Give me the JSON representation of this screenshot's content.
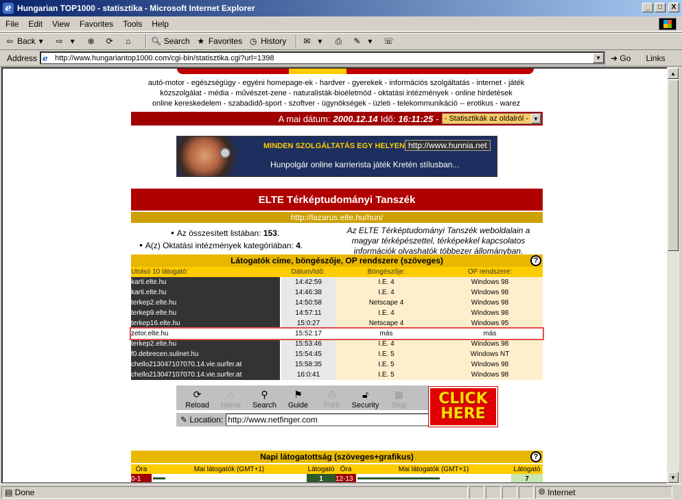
{
  "window": {
    "title": "Hungarian TOP1000 - statisztika - Microsoft Internet Explorer",
    "min": "_",
    "max": "□",
    "close": "X"
  },
  "menu": [
    "File",
    "Edit",
    "View",
    "Favorites",
    "Tools",
    "Help"
  ],
  "toolbar": {
    "back": "Back",
    "search": "Search",
    "favorites": "Favorites",
    "history": "History"
  },
  "address": {
    "label": "Address",
    "url": "http://www.hungariantop1000.com/cgi-bin/statisztika.cgi?url=1398",
    "go": "Go",
    "links": "Links"
  },
  "categories": [
    "autó-motor - egészségügy - egyéni homepage-ek - hardver - gyerekek - információs szolgáltatás - internet - játék",
    "közszolgálat - média - művészet-zene - naturalisták-bioéletmód - oktatási intézmények - online hirdetések",
    "online kereskedelem - szabadidő-sport - szoftver - ügynökségek - üzleti - telekommunikáció -- erotikus - warez"
  ],
  "datebar": {
    "prefix": "A mai dátum:",
    "date": "2000.12.14",
    "time_label": "Idő:",
    "time": "16:11:25",
    "dash": "-",
    "select": "- Statisztikák az oldalról -"
  },
  "banner": {
    "slogan": "MINDEN SZOLGÁLTATÁS EGY HELYEN!!!",
    "url": "http://www.hunnia.net",
    "desc": "Hunpolgár online karrierista játék Kretén stílusban..."
  },
  "site": {
    "title": "ELTE Térképtudományi Tanszék",
    "url": "http://lazarus.elte.hu/hun/",
    "rank1_label": "Az összesített listában:",
    "rank1": "153",
    "rank2_label": "A(z) Oktatási intézmények kategóriában:",
    "rank2": "4",
    "note": "Az ELTE Térképtudományi Tanszék weboldalain a magyar térképészettel, térképekkel kapcsolatos információk olvashatók többezer állományban."
  },
  "visitors": {
    "heading": "Látogatók címe, böngészője, OP rendszere (szöveges)",
    "help": "?",
    "columns": [
      "Utolsó 10 látogató:",
      "Dátum/Idő:",
      "Böngészője:",
      "OP rendszere:"
    ],
    "rows": [
      [
        "karti.elte.hu",
        "14:42:59",
        "I.E. 4",
        "Windows 98"
      ],
      [
        "karti.elte.hu",
        "14:46:38",
        "I.E. 4",
        "Windows 98"
      ],
      [
        "terkep2.elte.hu",
        "14:50:58",
        "Netscape 4",
        "Windows 98"
      ],
      [
        "terkep9.elte.hu",
        "14:57:11",
        "I.E. 4",
        "Windows 98"
      ],
      [
        "terkep16.elte.hu",
        "15:0:27",
        "Netscape 4",
        "Windows 95"
      ],
      [
        "zetor.elte.hu",
        "15:52:17",
        "más",
        "más"
      ],
      [
        "terkep2.elte.hu",
        "15:53:46",
        "I.E. 4",
        "Windows 98"
      ],
      [
        "f0.debrecen.sulinet.hu",
        "15:54:45",
        "I.E. 5",
        "Windows NT"
      ],
      [
        "chello213047107070.14.vie.surfer.at",
        "15:58:35",
        "I.E. 5",
        "Windows 98"
      ],
      [
        "chello213047107070.14.vie.surfer.at",
        "16:0:41",
        "I.E. 5",
        "Windows 98"
      ]
    ]
  },
  "navtoolbar": {
    "buttons": [
      "Reload",
      "Home",
      "Search",
      "Guide",
      "Print",
      "Security",
      "Stop"
    ],
    "location_label": "Location:",
    "location": "http://www.netfinger.com",
    "ad1": "CLICK",
    "ad2": "HERE"
  },
  "daily": {
    "heading": "Napi látogatottság (szöveges+grafikus)",
    "help": "?",
    "columns": [
      "Óra",
      "Mai látogatók (GMT+1)",
      "Látogató",
      "Óra",
      "Mai látogatók (GMT+1)",
      "Látogató"
    ],
    "row": {
      "h1": "0-1",
      "v1": "1",
      "h2": "12-13",
      "v2": "7"
    }
  },
  "status": {
    "text": "Done",
    "zone": "Internet"
  }
}
